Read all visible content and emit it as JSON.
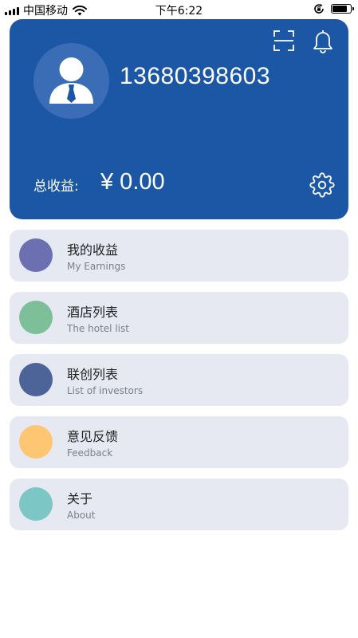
{
  "status_bar": {
    "carrier": "中国移动",
    "time": "下午6:22",
    "battery_level": 0.85
  },
  "header": {
    "phone": "13680398603",
    "earnings_label": "总收益:",
    "earnings_value": "¥ 0.00",
    "background_color": "#1c57a5"
  },
  "menu": [
    {
      "title": "我的收益",
      "subtitle": "My Earnings",
      "color": "#6d70b0"
    },
    {
      "title": "酒店列表",
      "subtitle": "The hotel list",
      "color": "#7dbf99"
    },
    {
      "title": "联创列表",
      "subtitle": "List of investors",
      "color": "#4d6499"
    },
    {
      "title": "意见反馈",
      "subtitle": "Feedback",
      "color": "#fdc673"
    },
    {
      "title": "关于",
      "subtitle": "About",
      "color": "#7cc6c5"
    }
  ]
}
